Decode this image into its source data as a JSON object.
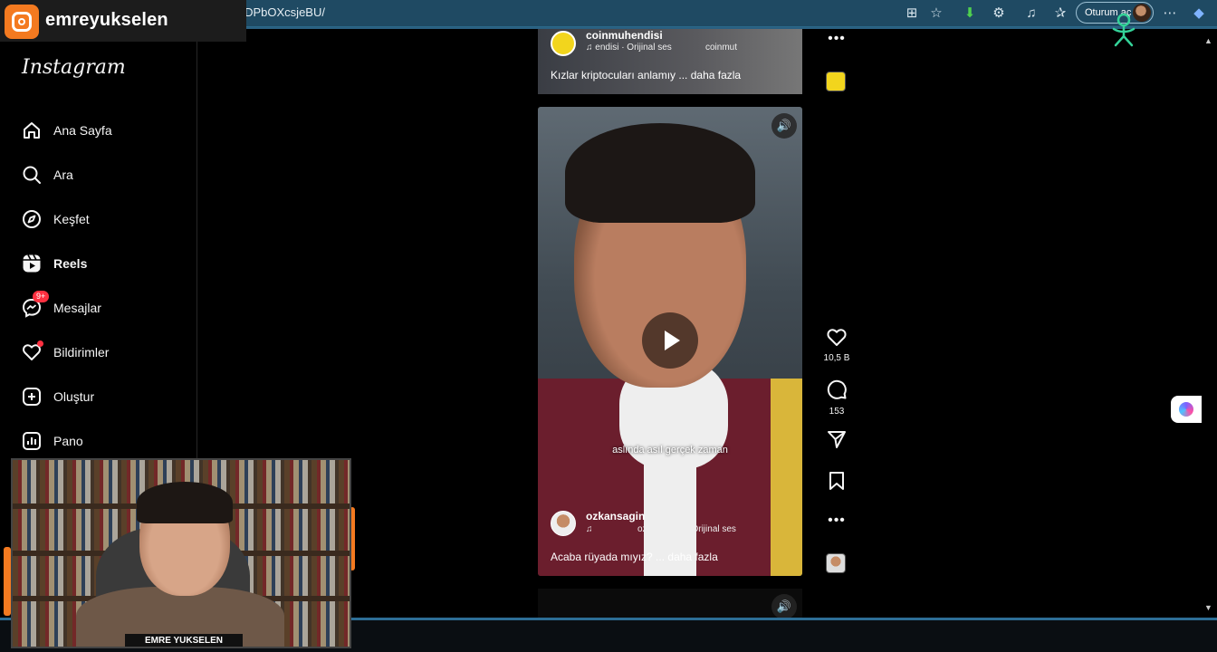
{
  "browser": {
    "url": "s/DPbOXcsjeBU/",
    "signin_label": "Oturum aç"
  },
  "stream": {
    "channel_name": "emreyukselen",
    "webcam_label": "EMRE YUKSELEN"
  },
  "instagram": {
    "logo": "Instagram",
    "nav": [
      {
        "label": "Ana Sayfa",
        "icon": "home-icon"
      },
      {
        "label": "Ara",
        "icon": "search-icon"
      },
      {
        "label": "Keşfet",
        "icon": "compass-icon"
      },
      {
        "label": "Reels",
        "icon": "reels-icon",
        "active": true
      },
      {
        "label": "Mesajlar",
        "icon": "messenger-icon",
        "badge": "9+"
      },
      {
        "label": "Bildirimler",
        "icon": "heart-icon",
        "dot": true
      },
      {
        "label": "Oluştur",
        "icon": "plus-square-icon"
      },
      {
        "label": "Pano",
        "icon": "dashboard-icon"
      }
    ]
  },
  "reels": {
    "previous": {
      "username": "coinmuhendisi",
      "audio_prefix": "endisi · Orijinal ses",
      "audio_suffix": "coinmut",
      "caption": "Kızlar kriptocuları anlamıy ... daha fazla"
    },
    "current": {
      "username": "ozkansagin",
      "audio": "ozkansagin · Orijinal ses",
      "caption": "Acaba rüyada mıyız? ... daha fazla",
      "subtitle": "aslında asıl gerçek zaman",
      "likes": "10,5 B",
      "comments": "153"
    },
    "more_glyph": "•••",
    "mute_glyph": "🔊"
  },
  "colors": {
    "browser_bar": "#1f4a63",
    "stream_orange": "#f47a20",
    "notification_red": "#ff3040"
  }
}
